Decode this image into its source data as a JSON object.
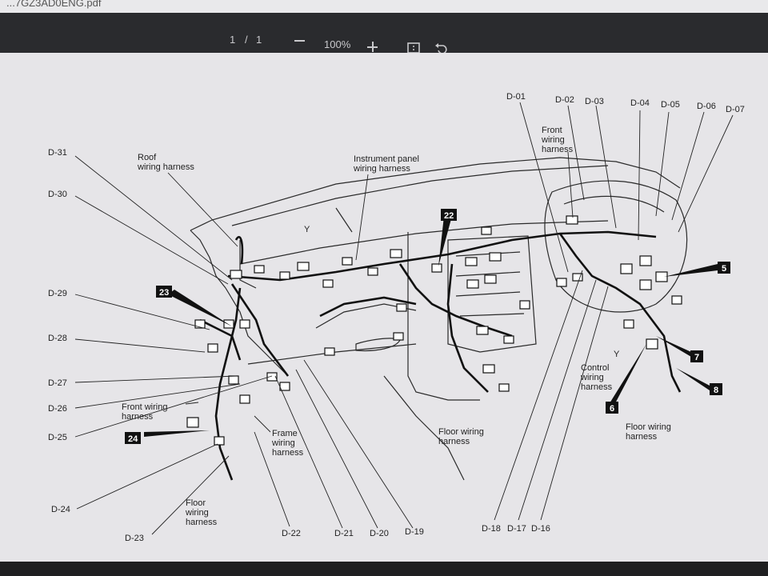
{
  "viewer": {
    "filename": "...7GZ3AD0ENG.pdf",
    "page_current": "1",
    "page_sep": "/",
    "page_total": "1",
    "zoom": "100%",
    "zoom_out_icon": "minus-icon",
    "zoom_in_icon": "plus-icon",
    "fit_icon": "fit-page-icon",
    "rotate_icon": "rotate-icon"
  },
  "diagram": {
    "harness_labels": {
      "roof": [
        "Roof",
        "wiring harness"
      ],
      "instrument": [
        "Instrument panel",
        "wiring harness"
      ],
      "front_top": [
        "Front",
        "wiring",
        "harness"
      ],
      "front_left": [
        "Front wiring",
        "harness"
      ],
      "frame": [
        "Frame",
        "wiring",
        "harness"
      ],
      "floor_left": [
        "Floor",
        "wiring",
        "harness"
      ],
      "floor_center": [
        "Floor wiring",
        "harness"
      ],
      "control": [
        "Control",
        "wiring",
        "harness"
      ],
      "floor_right": [
        "Floor wiring",
        "harness"
      ]
    },
    "y_marks": [
      "Y",
      "Y"
    ],
    "connectors_left": [
      "D-31",
      "D-30",
      "D-29",
      "D-28",
      "D-27",
      "D-26",
      "D-25",
      "D-24",
      "D-23"
    ],
    "connectors_top": [
      "D-01",
      "D-02",
      "D-03",
      "D-04",
      "D-05",
      "D-06",
      "D-07"
    ],
    "connectors_bottom": [
      "D-22",
      "D-21",
      "D-20",
      "D-19",
      "D-18",
      "D-17",
      "D-16"
    ],
    "callouts": [
      "22",
      "23",
      "24",
      "5",
      "7",
      "8",
      "6"
    ]
  }
}
